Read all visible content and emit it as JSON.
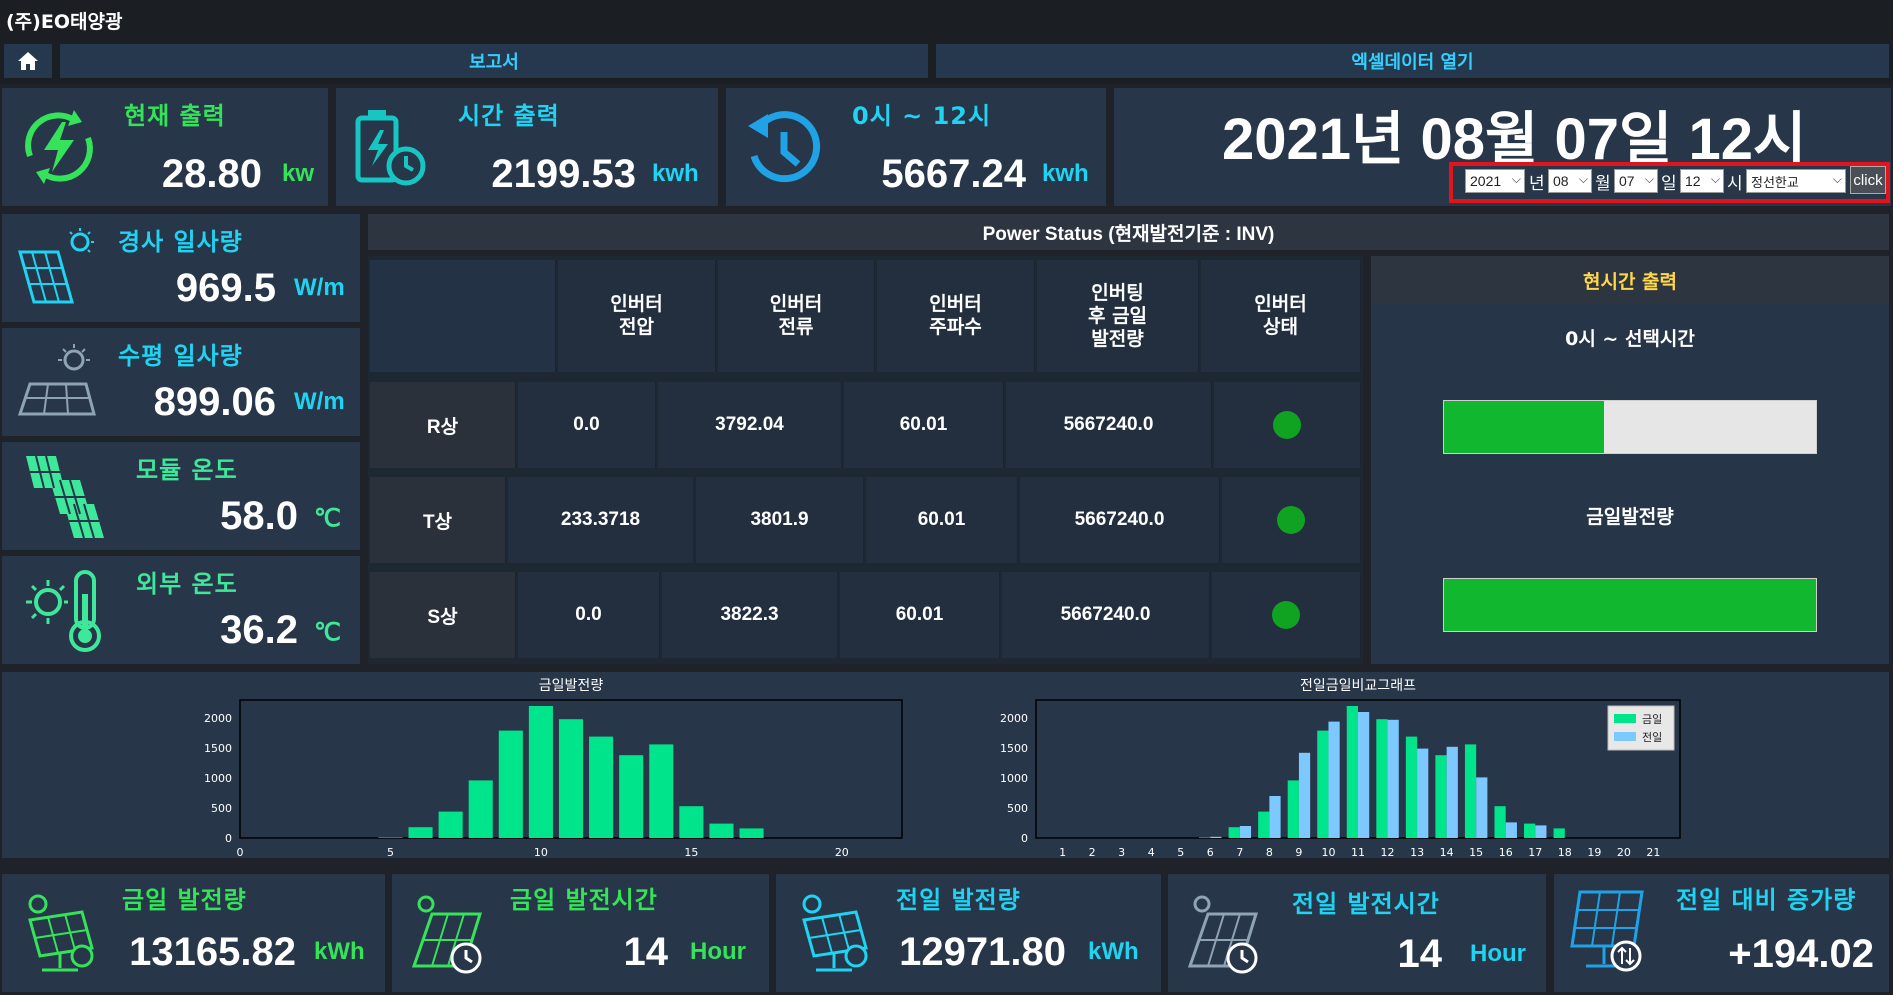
{
  "app": {
    "title": "(주)EO태양광"
  },
  "nav": {
    "home_icon": "home-icon",
    "report_label": "보고서",
    "excel_label": "엑셀데이터 열기"
  },
  "kpis": {
    "current": {
      "title": "현재 출력",
      "value": "28.80",
      "unit": "kw",
      "icon": "power-cycle-icon",
      "color": "#35e35a"
    },
    "hourly": {
      "title": "시간 출력",
      "value": "2199.53",
      "unit": "kwh",
      "icon": "battery-clock-icon",
      "color": "#1fd4f2"
    },
    "range": {
      "title": "0시 ~ 12시",
      "value": "5667.24",
      "unit": "kwh",
      "icon": "history-icon",
      "color": "#1fd4f2"
    }
  },
  "datetime": {
    "display": "2021년 08월 07일 12시",
    "year": "2021",
    "year_label": "년",
    "month": "08",
    "month_label": "월",
    "day": "07",
    "day_label": "일",
    "hour": "12",
    "hour_label": "시",
    "site": "정선한교",
    "click_label": "click"
  },
  "sensors": {
    "incline": {
      "title": "경사 일사량",
      "value": "969.5",
      "unit": "W/m",
      "icon": "tilted-solar-panel-icon"
    },
    "horizontal": {
      "title": "수평 일사량",
      "value": "899.06",
      "unit": "W/m",
      "icon": "flat-solar-panel-icon"
    },
    "module_temp": {
      "title": "모듈 온도",
      "value": "58.0",
      "unit": "℃",
      "icon": "solar-module-icon"
    },
    "outdoor_temp": {
      "title": "외부 온도",
      "value": "36.2",
      "unit": "℃",
      "icon": "sun-thermometer-icon"
    }
  },
  "power_status": {
    "title": "Power Status (현재발전기준 : INV)",
    "headers": [
      "인버터\n전압",
      "인버터\n전류",
      "인버터\n주파수",
      "인버팅\n후 금일\n발전량",
      "인버터\n상태"
    ],
    "rows": [
      {
        "phase": "R상",
        "voltage": "0.0",
        "current": "3792.04",
        "freq": "60.01",
        "energy": "5667240.0",
        "status": "green"
      },
      {
        "phase": "T상",
        "voltage": "233.3718",
        "current": "3801.9",
        "freq": "60.01",
        "energy": "5667240.0",
        "status": "green"
      },
      {
        "phase": "S상",
        "voltage": "0.0",
        "current": "3822.3",
        "freq": "60.01",
        "energy": "5667240.0",
        "status": "green"
      }
    ]
  },
  "realtime": {
    "title": "현시간 출력",
    "range_label": "0시 ~ 선택시간",
    "range_progress": 0.43,
    "daily_label": "금일발전량",
    "daily_progress": 1.0
  },
  "chart_data": [
    {
      "type": "bar",
      "title": "금일발전량",
      "x": [
        5,
        6,
        7,
        8,
        9,
        10,
        11,
        12,
        13,
        14,
        15,
        16,
        17,
        18
      ],
      "values": [
        10,
        180,
        440,
        960,
        1790,
        2200,
        1980,
        1690,
        1380,
        1560,
        530,
        240,
        160,
        0
      ],
      "xticks": [
        0,
        5,
        10,
        15,
        20
      ],
      "yticks": [
        0,
        500,
        1000,
        1500,
        2000
      ],
      "xlim": [
        0,
        22
      ],
      "ylim": [
        0,
        2300
      ],
      "color": "#00e58c"
    },
    {
      "type": "bar",
      "title": "전일금일비교그래프",
      "categories": [
        "1",
        "2",
        "3",
        "4",
        "5",
        "6",
        "7",
        "8",
        "9",
        "10",
        "11",
        "12",
        "13",
        "14",
        "15",
        "16",
        "17",
        "18",
        "19",
        "20",
        "21"
      ],
      "series": [
        {
          "name": "금일",
          "color": "#00e58c",
          "values": [
            0,
            0,
            0,
            0,
            0,
            10,
            180,
            440,
            960,
            1790,
            2200,
            1980,
            1690,
            1380,
            1560,
            530,
            240,
            160,
            0,
            0,
            0
          ]
        },
        {
          "name": "전일",
          "color": "#7cc8ff",
          "values": [
            0,
            0,
            0,
            0,
            0,
            20,
            200,
            700,
            1420,
            1940,
            2100,
            1970,
            1490,
            1520,
            1010,
            260,
            210,
            0,
            0,
            0,
            0
          ]
        }
      ],
      "yticks": [
        0,
        500,
        1000,
        1500,
        2000
      ],
      "ylim": [
        0,
        2300
      ],
      "legend": "top-right"
    }
  ],
  "bottom": {
    "today_energy": {
      "title": "금일 발전량",
      "value": "13165.82",
      "unit": "kWh",
      "icon": "solar-panel-gear-icon"
    },
    "today_hours": {
      "title": "금일 발전시간",
      "value": "14",
      "unit": "Hour",
      "icon": "solar-panel-clock-icon"
    },
    "yesterday_energy": {
      "title": "전일 발전량",
      "value": "12971.80",
      "unit": "kWh",
      "icon": "solar-panel-gear-icon"
    },
    "yesterday_hours": {
      "title": "전일 발전시간",
      "value": "14",
      "unit": "Hour",
      "icon": "solar-panel-clock-icon"
    },
    "increase": {
      "title": "전일 대비 증가량",
      "value": "+194.02",
      "icon": "solar-panel-exchange-icon"
    }
  },
  "colors": {
    "background": "#1f2329",
    "panel": "#273648",
    "accent_green": "#35e35a",
    "accent_cyan": "#1fd4f2",
    "bar": "#00e58c",
    "highlight_box": "#e0141c"
  }
}
